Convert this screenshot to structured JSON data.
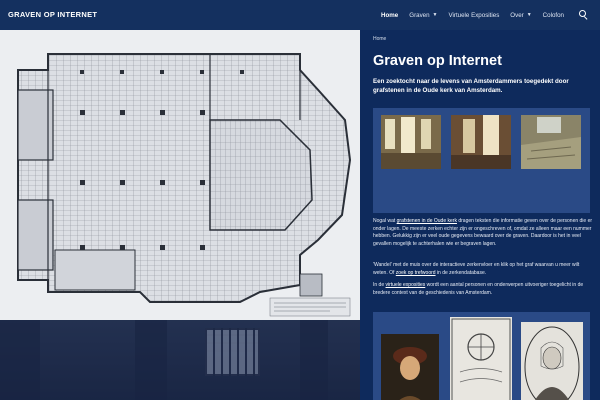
{
  "header": {
    "site_title": "GRAVEN OP INTERNET",
    "nav": [
      {
        "label": "Home",
        "active": true,
        "dropdown": false
      },
      {
        "label": "Graven",
        "active": false,
        "dropdown": true
      },
      {
        "label": "Virtuele Exposities",
        "active": false,
        "dropdown": false
      },
      {
        "label": "Over",
        "active": false,
        "dropdown": true
      },
      {
        "label": "Colofon",
        "active": false,
        "dropdown": false
      }
    ],
    "search_icon": "search-icon"
  },
  "breadcrumb": "Home",
  "title": "Graven op Internet",
  "intro": "Een zoektocht naar de levens van Amsterdammers toegedekt door grafstenen in de Oude kerk van Amsterdam.",
  "paragraph1": {
    "before": "Nogal wat ",
    "link": "grafstenen in de Oude kerk",
    "after": " dragen teksten die informatie geven over de personen die er onder lagen. De meeste zerken echter zijn er ongeschreven of, omdat ze alleen maar een nummer hebben. Gelukkig zijn er veel oude gegevens bewaard over de graven. Daardoor is het in veel gevallen mogelijk te achterhalen wie er begraven lagen."
  },
  "paragraph2": {
    "before": "'Wandel' met de muis over de interactieve zerkenvloer en klik op het graf waarvan u meer wilt weten. Of ",
    "link": "zoek op trefwoord",
    "after": " in de zerkendatabase."
  },
  "paragraph3": {
    "before": "In de ",
    "link": "virtuele exposities",
    "after": " wordt een aantal personen en onderwerpen uitvoeriger toegelicht in de bredere context van de geschiedenis van Amsterdam."
  },
  "colors": {
    "header_bg": "#14305f",
    "panel_bg": "#0e2a5c",
    "box_bg": "#2a4a86",
    "text": "#ffffff"
  }
}
